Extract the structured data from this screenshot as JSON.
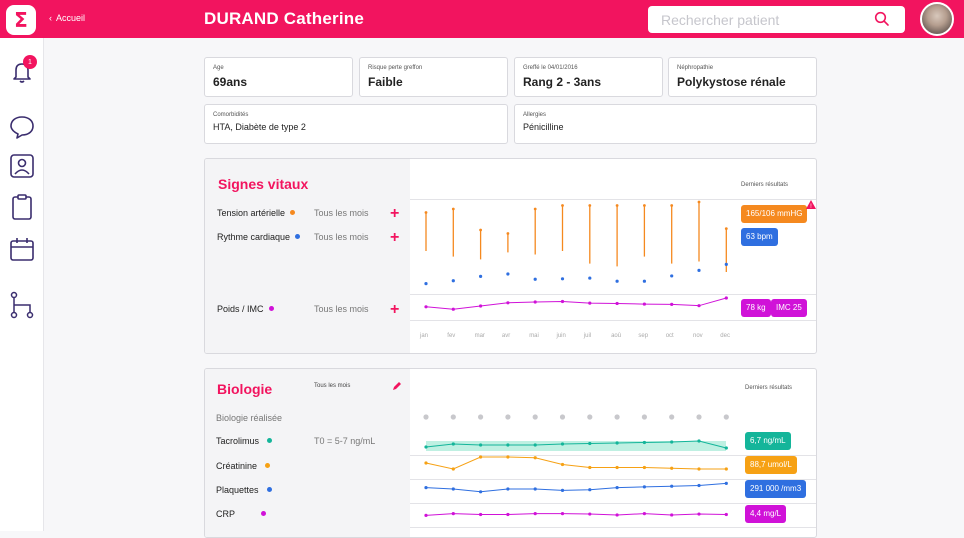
{
  "header": {
    "logo_glyph": "Σ",
    "back_label": "Accueil",
    "patient_name": "DURAND Catherine",
    "search_placeholder": "Rechercher patient"
  },
  "sidebar": {
    "notifications_count": "1",
    "icons": [
      "bell-icon",
      "chat-bubble-icon",
      "patient-card-icon",
      "clipboard-icon",
      "calendar-icon",
      "hierarchy-icon"
    ]
  },
  "info_cards": {
    "age": {
      "label": "Age",
      "value": "69ans"
    },
    "risk": {
      "label": "Risque perte greffon",
      "value": "Faible"
    },
    "graft": {
      "label": "Greffé le 04/01/2016",
      "value": "Rang 2 - 3ans"
    },
    "nephro": {
      "label": "Néphropathie",
      "value": "Polykystose rénale"
    },
    "comorb": {
      "label": "Comorbidités",
      "value": "HTA, Diabète de type 2"
    },
    "allergies": {
      "label": "Allergies",
      "value": "Pénicilline"
    }
  },
  "vitals": {
    "title": "Signes vitaux",
    "latest_label": "Derniers résultats",
    "months": [
      "jan",
      "fev",
      "mar",
      "avr",
      "mai",
      "juin",
      "juil",
      "aoû",
      "sep",
      "oct",
      "nov",
      "dec"
    ],
    "rows": [
      {
        "label": "Tension artérielle",
        "frequency": "Tous les mois",
        "color": "#f5891f",
        "latest": "165/106 mmHG",
        "alert": "!"
      },
      {
        "label": "Rythme cardiaque",
        "frequency": "Tous les mois",
        "color": "#2f6fe0",
        "latest": "63 bpm"
      },
      {
        "label": "Poids / IMC",
        "frequency": "Tous les mois",
        "color": "#d012d8",
        "latest": "78 kg",
        "latest2": "IMC 25"
      }
    ],
    "bp_relative": [
      [
        0.3,
        0.85
      ],
      [
        0.22,
        0.9
      ],
      [
        0.18,
        0.6
      ],
      [
        0.28,
        0.55
      ],
      [
        0.25,
        0.9
      ],
      [
        0.3,
        0.95
      ],
      [
        0.12,
        0.95
      ],
      [
        0.08,
        0.95
      ],
      [
        0.22,
        0.95
      ],
      [
        0.12,
        0.95
      ],
      [
        0.15,
        1.0
      ],
      [
        0.0,
        0.62
      ]
    ],
    "hr_relative": [
      0.1,
      0.22,
      0.4,
      0.5,
      0.28,
      0.3,
      0.33,
      0.2,
      0.2,
      0.42,
      0.65,
      0.9
    ],
    "weight_relative": [
      0.45,
      0.3,
      0.5,
      0.7,
      0.75,
      0.78,
      0.68,
      0.66,
      0.62,
      0.6,
      0.52,
      1.0
    ]
  },
  "biology": {
    "title": "Biologie",
    "frequency": "Tous les mois",
    "latest_label": "Derniers résultats",
    "performed_label": "Biologie réalisée",
    "rows": [
      {
        "label": "Tacrolimus",
        "extra": "T0 = 5-7 ng/mL",
        "color": "#14b59a",
        "latest": "6,7 ng/mL"
      },
      {
        "label": "Créatinine",
        "color": "#f6a114",
        "latest": "88,7 umol/L"
      },
      {
        "label": "Plaquettes",
        "color": "#2f6fe0",
        "latest": "291 000 /mm3"
      },
      {
        "label": "CRP",
        "color": "#d012d8",
        "latest": "4,4 mg/L"
      }
    ],
    "tacrolimus_relative": [
      0.3,
      0.6,
      0.5,
      0.5,
      0.5,
      0.6,
      0.65,
      0.7,
      0.75,
      0.8,
      0.9,
      0.2
    ],
    "creatinine_relative": [
      0.6,
      0.2,
      1.0,
      1.0,
      0.95,
      0.5,
      0.3,
      0.3,
      0.3,
      0.25,
      0.2,
      0.2
    ],
    "platelets_relative": [
      0.6,
      0.5,
      0.3,
      0.5,
      0.5,
      0.4,
      0.45,
      0.6,
      0.65,
      0.7,
      0.75,
      0.9
    ],
    "crp_relative": [
      0.4,
      0.6,
      0.5,
      0.5,
      0.6,
      0.6,
      0.55,
      0.45,
      0.6,
      0.45,
      0.55,
      0.5
    ]
  },
  "colors": {
    "accent": "#f2145f"
  }
}
